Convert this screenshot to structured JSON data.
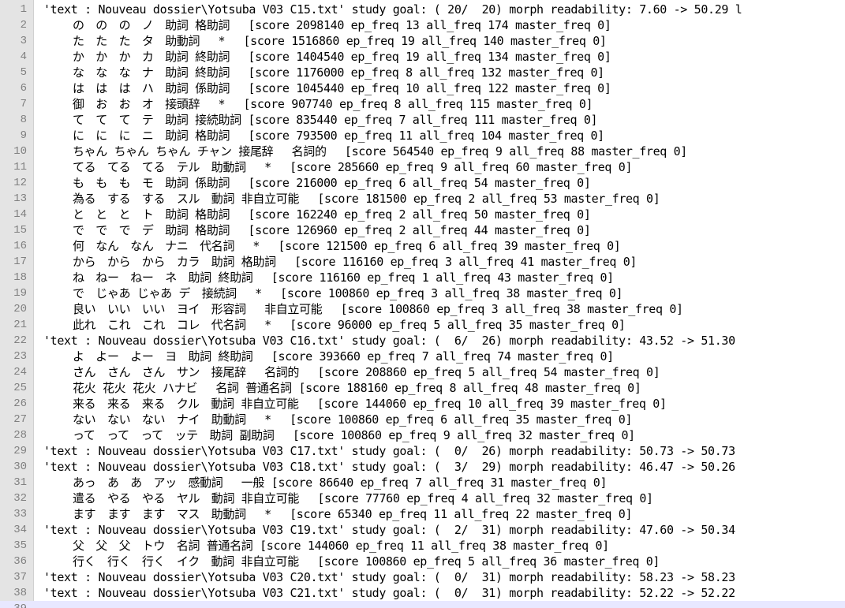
{
  "editor": {
    "lines": [
      {
        "n": "1",
        "text": "'text : Nouveau dossier\\Yotsuba V03 C15.txt' study goal: ( 20/  20) morph readability: 7.60 -> 50.29 l",
        "indent": false
      },
      {
        "n": "2",
        "text": "の　の　の　ノ　助詞 格助詞　 [score 2098140 ep_freq 13 all_freq 174 master_freq 0]",
        "indent": true
      },
      {
        "n": "3",
        "text": "た　た　た　タ　助動詞　 *　 [score 1516860 ep_freq 19 all_freq 140 master_freq 0]",
        "indent": true
      },
      {
        "n": "4",
        "text": "か　か　か　カ　助詞 終助詞　 [score 1404540 ep_freq 19 all_freq 134 master_freq 0]",
        "indent": true
      },
      {
        "n": "5",
        "text": "な　な　な　ナ　助詞 終助詞　 [score 1176000 ep_freq 8 all_freq 132 master_freq 0]",
        "indent": true
      },
      {
        "n": "6",
        "text": "は　は　は　ハ　助詞 係助詞　 [score 1045440 ep_freq 10 all_freq 122 master_freq 0]",
        "indent": true
      },
      {
        "n": "7",
        "text": "御　お　お　オ　接頭辞　 *　 [score 907740 ep_freq 8 all_freq 115 master_freq 0]",
        "indent": true
      },
      {
        "n": "8",
        "text": "て　て　て　テ　助詞 接続助詞 [score 835440 ep_freq 7 all_freq 111 master_freq 0]",
        "indent": true
      },
      {
        "n": "9",
        "text": "に　に　に　ニ　助詞 格助詞　 [score 793500 ep_freq 11 all_freq 104 master_freq 0]",
        "indent": true
      },
      {
        "n": "10",
        "text": "ちゃん ちゃん ちゃん チャン 接尾辞　 名詞的　 [score 564540 ep_freq 9 all_freq 88 master_freq 0]",
        "indent": true
      },
      {
        "n": "11",
        "text": "てる　てる　てる　テル　助動詞　 *　 [score 285660 ep_freq 9 all_freq 60 master_freq 0]",
        "indent": true
      },
      {
        "n": "12",
        "text": "も　も　も　モ　助詞 係助詞　 [score 216000 ep_freq 6 all_freq 54 master_freq 0]",
        "indent": true
      },
      {
        "n": "13",
        "text": "為る　する　する　スル　動詞 非自立可能　 [score 181500 ep_freq 2 all_freq 53 master_freq 0]",
        "indent": true
      },
      {
        "n": "14",
        "text": "と　と　と　ト　助詞 格助詞　 [score 162240 ep_freq 2 all_freq 50 master_freq 0]",
        "indent": true
      },
      {
        "n": "15",
        "text": "で　で　で　デ　助詞 格助詞　 [score 126960 ep_freq 2 all_freq 44 master_freq 0]",
        "indent": true
      },
      {
        "n": "16",
        "text": "何　なん　なん　ナニ　代名詞　 *　 [score 121500 ep_freq 6 all_freq 39 master_freq 0]",
        "indent": true
      },
      {
        "n": "17",
        "text": "から　から　から　カラ　助詞 格助詞　 [score 116160 ep_freq 3 all_freq 41 master_freq 0]",
        "indent": true
      },
      {
        "n": "18",
        "text": "ね　ねー　ねー　ネ　助詞 終助詞　 [score 116160 ep_freq 1 all_freq 43 master_freq 0]",
        "indent": true
      },
      {
        "n": "19",
        "text": "で　じゃあ じゃあ デ　接続詞　 *　 [score 100860 ep_freq 3 all_freq 38 master_freq 0]",
        "indent": true
      },
      {
        "n": "20",
        "text": "良い　いい　いい　ヨイ　形容詞　 非自立可能　 [score 100860 ep_freq 3 all_freq 38 master_freq 0]",
        "indent": true
      },
      {
        "n": "21",
        "text": "此れ　これ　これ　コレ　代名詞　 *　 [score 96000 ep_freq 5 all_freq 35 master_freq 0]",
        "indent": true
      },
      {
        "n": "22",
        "text": "'text : Nouveau dossier\\Yotsuba V03 C16.txt' study goal: (  6/  26) morph readability: 43.52 -> 51.30",
        "indent": false
      },
      {
        "n": "23",
        "text": "よ　よー　よー　ヨ　助詞 終助詞　 [score 393660 ep_freq 7 all_freq 74 master_freq 0]",
        "indent": true
      },
      {
        "n": "24",
        "text": "さん　さん　さん　サン　接尾辞　 名詞的　 [score 208860 ep_freq 5 all_freq 54 master_freq 0]",
        "indent": true
      },
      {
        "n": "25",
        "text": "花火 花火 花火 ハナビ　 名詞 普通名詞 [score 188160 ep_freq 8 all_freq 48 master_freq 0]",
        "indent": true
      },
      {
        "n": "26",
        "text": "来る　来る　来る　クル　動詞 非自立可能　 [score 144060 ep_freq 10 all_freq 39 master_freq 0]",
        "indent": true
      },
      {
        "n": "27",
        "text": "ない　ない　ない　ナイ　助動詞　 *　 [score 100860 ep_freq 6 all_freq 35 master_freq 0]",
        "indent": true
      },
      {
        "n": "28",
        "text": "って　って　って　ッテ　助詞 副助詞　 [score 100860 ep_freq 9 all_freq 32 master_freq 0]",
        "indent": true
      },
      {
        "n": "29",
        "text": "'text : Nouveau dossier\\Yotsuba V03 C17.txt' study goal: (  0/  26) morph readability: 50.73 -> 50.73",
        "indent": false
      },
      {
        "n": "30",
        "text": "'text : Nouveau dossier\\Yotsuba V03 C18.txt' study goal: (  3/  29) morph readability: 46.47 -> 50.26",
        "indent": false
      },
      {
        "n": "31",
        "text": "あっ　あ　あ　アッ　感動詞　 一般 [score 86640 ep_freq 7 all_freq 31 master_freq 0]",
        "indent": true
      },
      {
        "n": "32",
        "text": "遣る　やる　やる　ヤル　動詞 非自立可能　 [score 77760 ep_freq 4 all_freq 32 master_freq 0]",
        "indent": true
      },
      {
        "n": "33",
        "text": "ます　ます　ます　マス　助動詞　 *　 [score 65340 ep_freq 11 all_freq 22 master_freq 0]",
        "indent": true
      },
      {
        "n": "34",
        "text": "'text : Nouveau dossier\\Yotsuba V03 C19.txt' study goal: (  2/  31) morph readability: 47.60 -> 50.34",
        "indent": false
      },
      {
        "n": "35",
        "text": "父　父　父　トウ　名詞 普通名詞 [score 144060 ep_freq 11 all_freq 38 master_freq 0]",
        "indent": true
      },
      {
        "n": "36",
        "text": "行く　行く　行く　イク　動詞 非自立可能　 [score 100860 ep_freq 5 all_freq 36 master_freq 0]",
        "indent": true
      },
      {
        "n": "37",
        "text": "'text : Nouveau dossier\\Yotsuba V03 C20.txt' study goal: (  0/  31) morph readability: 58.23 -> 58.23",
        "indent": false
      },
      {
        "n": "38",
        "text": "'text : Nouveau dossier\\Yotsuba V03 C21.txt' study goal: (  0/  31) morph readability: 52.22 -> 52.22",
        "indent": false
      },
      {
        "n": "39",
        "text": "",
        "indent": false
      }
    ],
    "current_line": "39",
    "colors": {
      "gutter_bg": "#e4e4e4",
      "line_number": "#808080",
      "current_line_bg": "#e8e8ff",
      "text": "#000000"
    }
  }
}
